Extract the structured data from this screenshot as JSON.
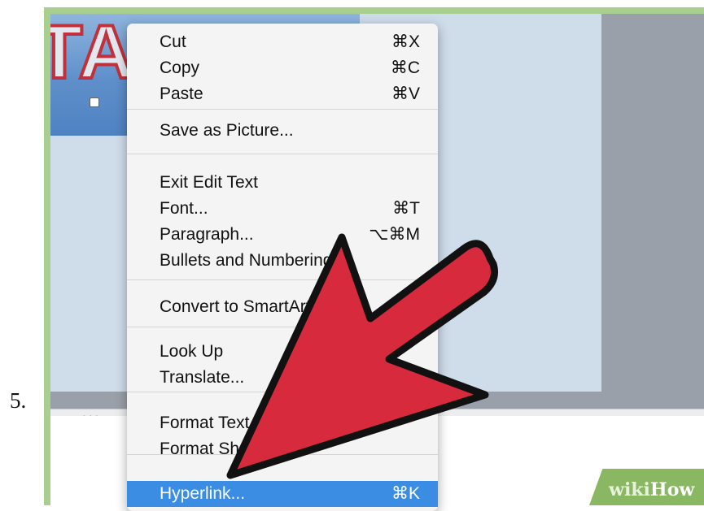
{
  "step": {
    "number": "5."
  },
  "slide": {
    "title_fragment": "TAI"
  },
  "watermark": {
    "wiki": "wiki",
    "how": "How"
  },
  "menu": {
    "groups": [
      [
        {
          "label": "Cut",
          "shortcut": "⌘X"
        },
        {
          "label": "Copy",
          "shortcut": "⌘C"
        },
        {
          "label": "Paste",
          "shortcut": "⌘V"
        }
      ],
      [
        {
          "label": "Save as Picture...",
          "shortcut": ""
        }
      ],
      [
        {
          "label": "Exit Edit Text",
          "shortcut": ""
        },
        {
          "label": "Font...",
          "shortcut": "⌘T"
        },
        {
          "label": "Paragraph...",
          "shortcut": "⌥⌘M"
        },
        {
          "label": "Bullets and Numbering...",
          "shortcut": ""
        }
      ],
      [
        {
          "label": "Convert to SmartArt",
          "shortcut": ""
        }
      ],
      [
        {
          "label": "Look Up",
          "shortcut": ""
        },
        {
          "label": "Translate...",
          "shortcut": ""
        }
      ],
      [
        {
          "label": "Format Text...",
          "shortcut": ""
        },
        {
          "label": "Format Shape...",
          "shortcut": ""
        }
      ],
      [
        {
          "label": "Hyperlink...",
          "shortcut": "⌘K",
          "highlighted": true
        }
      ]
    ]
  },
  "colors": {
    "frame_border": "#a8cf8f",
    "arrow_fill": "#d72a3d",
    "highlight": "#3a8de2",
    "wikihow_green": "#8ab862"
  }
}
